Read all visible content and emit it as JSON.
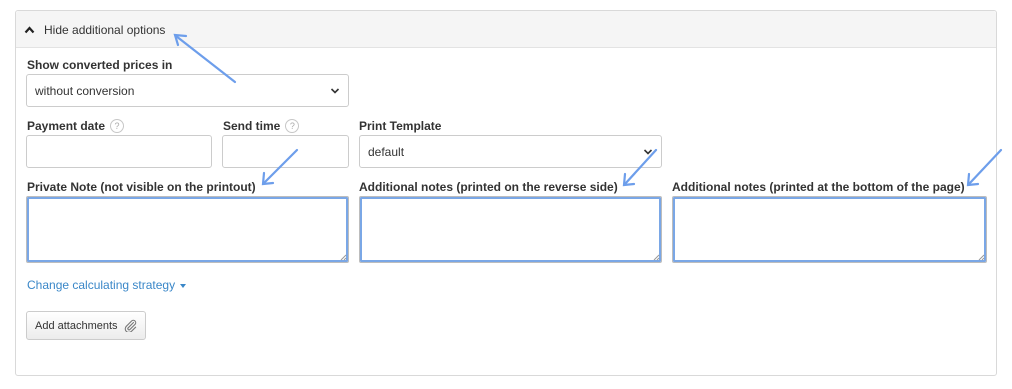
{
  "toggle": {
    "label": "Hide additional options",
    "icon": "chevron-up-icon"
  },
  "converted_prices": {
    "label": "Show converted prices in",
    "value": "without conversion"
  },
  "payment_date": {
    "label": "Payment date",
    "help": "?",
    "value": ""
  },
  "send_time": {
    "label": "Send time",
    "help": "?",
    "value": ""
  },
  "print_template": {
    "label": "Print Template",
    "value": "default"
  },
  "private_note": {
    "label": "Private Note (not visible on the printout)",
    "value": ""
  },
  "notes_reverse": {
    "label": "Additional notes (printed on the reverse side)",
    "value": ""
  },
  "notes_bottom": {
    "label": "Additional notes (printed at the bottom of the page)",
    "value": ""
  },
  "strategy_link": {
    "label": "Change calculating strategy"
  },
  "attach_button": {
    "label": "Add attachments",
    "icon": "paperclip-icon"
  },
  "colors": {
    "link": "#3a87c8",
    "highlight": "#7aa7e6",
    "annotation_arrow": "#6d9eeb"
  }
}
